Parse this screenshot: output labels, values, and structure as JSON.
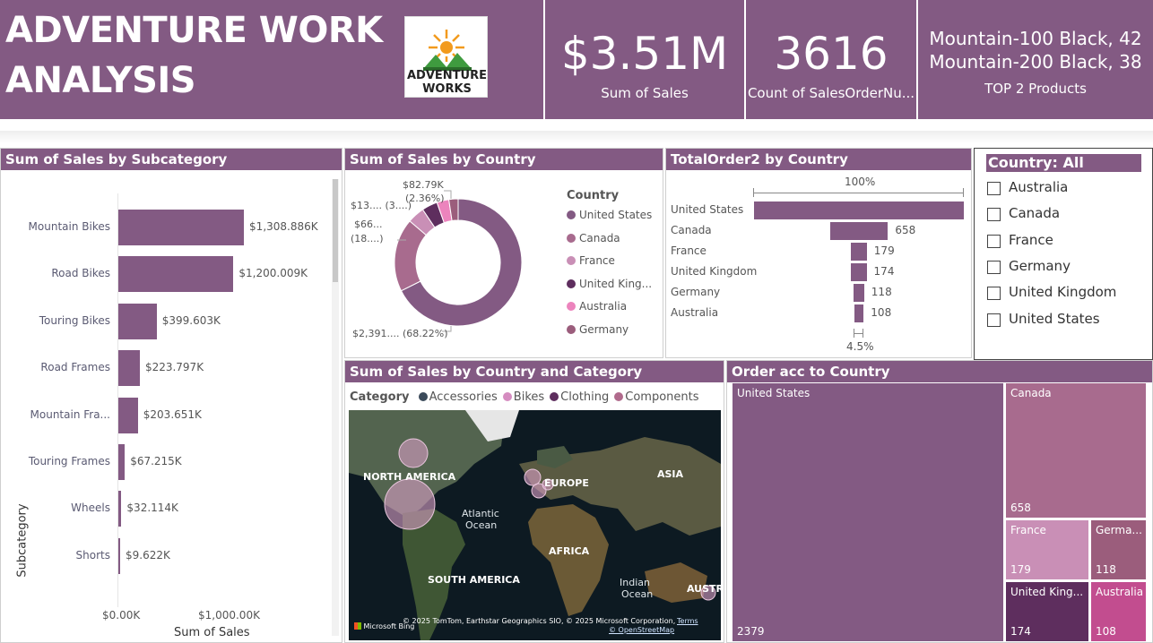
{
  "header": {
    "title_line1": "ADVENTURE WORK",
    "title_line2": "ANALYSIS",
    "logo_line1": "ADVENTURE",
    "logo_line2": "WORKS",
    "kpi_sales_value": "$3.51M",
    "kpi_sales_label": "Sum of Sales",
    "kpi_orders_value": "3616",
    "kpi_orders_label": "Count of SalesOrderNu...",
    "top_products_line1": "Mountain-100 Black, 42",
    "top_products_line2": "Mountain-200 Black, 38",
    "top_products_label": "TOP 2 Products"
  },
  "colors": {
    "primary": "#835a83",
    "slice_us": "#835a83",
    "slice_canada": "#a86b8e",
    "slice_france": "#c98fb6",
    "slice_uk": "#5e2e5e",
    "slice_australia": "#ec84bd",
    "slice_germany": "#9b5d7c"
  },
  "subcategory_chart": {
    "title": "Sum of Sales by Subcategory",
    "ylabel": "Subcategory",
    "xlabel": "Sum of Sales",
    "xticks": [
      "$0.00K",
      "$1,000.00K"
    ]
  },
  "country_donut": {
    "title": "Sum of Sales by Country",
    "legend_title": "Country",
    "legend": [
      "United States",
      "Canada",
      "France",
      "United King...",
      "Australia",
      "Germany"
    ],
    "labels": {
      "germany_a": "$82.79K",
      "germany_b": "(2.36%)",
      "australia": "$13.... (3....)",
      "canada_a": "$66...",
      "canada_b": "(18....)",
      "us": "$2,391.... (68.22%)"
    }
  },
  "funnel_chart": {
    "title": "TotalOrder2 by Country",
    "top_pct": "100%",
    "bottom_pct": "4.5%"
  },
  "slicer": {
    "header": "Country: All",
    "options": [
      "Australia",
      "Canada",
      "France",
      "Germany",
      "United Kingdom",
      "United States"
    ]
  },
  "map_panel": {
    "title": "Sum of Sales by Country and Category",
    "legend_title": "Category",
    "legend": [
      "Accessories",
      "Bikes",
      "Clothing",
      "Components"
    ],
    "legend_colors": [
      "#3b4a5a",
      "#d58cc0",
      "#5e2e5e",
      "#b06a8c"
    ],
    "places": {
      "north_america": "NORTH AMERICA",
      "europe": "EUROPE",
      "asia": "ASIA",
      "atlantic1": "Atlantic",
      "atlantic2": "Ocean",
      "africa": "AFRICA",
      "south_america": "SOUTH AMERICA",
      "indian1": "Indian",
      "indian2": "Ocean",
      "australia": "AUSTR"
    },
    "attribution": "© 2025 TomTom, Earthstar Geographics SIO, © 2025 Microsoft Corporation,",
    "terms": "Terms",
    "osm": "© OpenStreetMap",
    "bing": "Microsoft Bing"
  },
  "treemap": {
    "title": "Order acc to Country",
    "tiles": [
      {
        "name": "United States",
        "value": "2379",
        "color": "#835a83"
      },
      {
        "name": "Canada",
        "value": "658",
        "color": "#a86b8e"
      },
      {
        "name": "France",
        "value": "179",
        "color": "#c98fb6"
      },
      {
        "name": "Germa...",
        "value": "118",
        "color": "#9b5d7c"
      },
      {
        "name": "United King...",
        "value": "174",
        "color": "#5e2e5e"
      },
      {
        "name": "Australia",
        "value": "108",
        "color": "#c24d8f"
      }
    ]
  },
  "chart_data": [
    {
      "type": "bar",
      "title": "Sum of Sales by Subcategory",
      "xlabel": "Sum of Sales",
      "ylabel": "Subcategory",
      "xlim": [
        0,
        1000
      ],
      "categories": [
        "Mountain Bikes",
        "Road Bikes",
        "Touring Bikes",
        "Road Frames",
        "Mountain Fra...",
        "Touring Frames",
        "Wheels",
        "Shorts"
      ],
      "values": [
        1308.886,
        1200.009,
        399.603,
        223.797,
        203.651,
        67.215,
        32.114,
        9.622
      ],
      "value_labels": [
        "$1,308.886K",
        "$1,200.009K",
        "$399.603K",
        "$223.797K",
        "$203.651K",
        "$67.215K",
        "$32.114K",
        "$9.622K"
      ]
    },
    {
      "type": "pie",
      "title": "Sum of Sales by Country",
      "categories": [
        "United States",
        "Canada",
        "France",
        "United Kingdom",
        "Australia",
        "Germany"
      ],
      "values": [
        68.22,
        18.8,
        4.4,
        4.0,
        3.1,
        2.36
      ]
    },
    {
      "type": "bar",
      "title": "TotalOrder2 by Country",
      "categories": [
        "United States",
        "Canada",
        "France",
        "United Kingdom",
        "Germany",
        "Australia"
      ],
      "values": [
        2379,
        658,
        179,
        174,
        118,
        108
      ],
      "value_labels": [
        "",
        "658",
        "179",
        "174",
        "118",
        "108"
      ]
    }
  ]
}
